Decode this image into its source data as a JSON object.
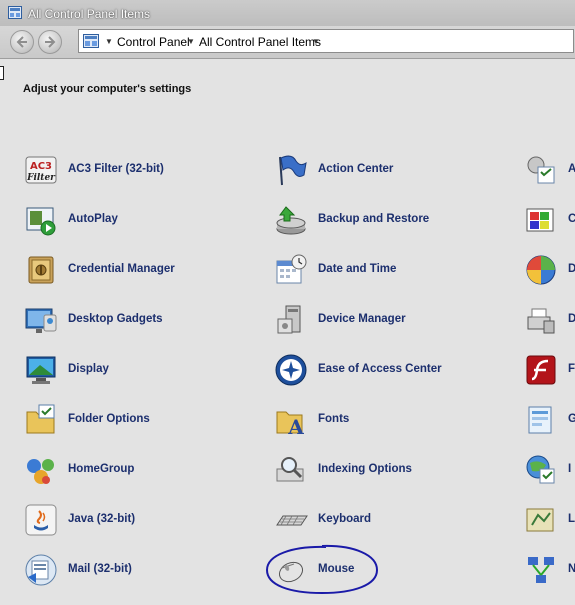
{
  "window": {
    "title": "All Control Panel Items",
    "title_icon": "control-panel-icon"
  },
  "nav": {
    "back_icon": "back-arrow-icon",
    "forward_icon": "forward-arrow-icon",
    "breadcrumb": [
      "Control Panel",
      "All Control Panel Items"
    ]
  },
  "content": {
    "heading": "Adjust your computer's settings",
    "columns": [
      {
        "items": [
          {
            "label": "AC3 Filter (32-bit)",
            "icon": "ac3-filter-icon"
          },
          {
            "label": "AutoPlay",
            "icon": "autoplay-icon"
          },
          {
            "label": "Credential Manager",
            "icon": "credential-manager-icon"
          },
          {
            "label": "Desktop Gadgets",
            "icon": "desktop-gadgets-icon"
          },
          {
            "label": "Display",
            "icon": "display-icon"
          },
          {
            "label": "Folder Options",
            "icon": "folder-options-icon"
          },
          {
            "label": "HomeGroup",
            "icon": "homegroup-icon"
          },
          {
            "label": "Java (32-bit)",
            "icon": "java-icon"
          },
          {
            "label": "Mail (32-bit)",
            "icon": "mail-icon"
          }
        ]
      },
      {
        "items": [
          {
            "label": "Action Center",
            "icon": "action-center-flag-icon"
          },
          {
            "label": "Backup and Restore",
            "icon": "backup-restore-icon"
          },
          {
            "label": "Date and Time",
            "icon": "date-time-icon"
          },
          {
            "label": "Device Manager",
            "icon": "device-manager-icon"
          },
          {
            "label": "Ease of Access Center",
            "icon": "ease-of-access-icon"
          },
          {
            "label": "Fonts",
            "icon": "fonts-icon"
          },
          {
            "label": "Indexing Options",
            "icon": "indexing-options-icon"
          },
          {
            "label": "Keyboard",
            "icon": "keyboard-icon"
          },
          {
            "label": "Mouse",
            "icon": "mouse-icon"
          }
        ]
      },
      {
        "items": [
          {
            "label": "A",
            "icon": "administrative-tools-icon"
          },
          {
            "label": "C",
            "icon": "color-management-icon"
          },
          {
            "label": "D",
            "icon": "default-programs-icon"
          },
          {
            "label": "D",
            "icon": "devices-printers-icon"
          },
          {
            "label": "F",
            "icon": "flash-player-icon"
          },
          {
            "label": "G",
            "icon": "getting-started-icon"
          },
          {
            "label": "I",
            "icon": "internet-options-icon"
          },
          {
            "label": "L",
            "icon": "location-sensors-icon"
          },
          {
            "label": "N",
            "icon": "network-sharing-icon"
          }
        ]
      }
    ]
  },
  "annotation": {
    "circled_item": "Mouse",
    "color": "#1a1aa8"
  }
}
